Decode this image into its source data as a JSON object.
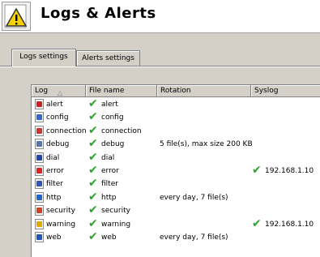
{
  "header": {
    "title": "Logs & Alerts",
    "icon": "warning-icon"
  },
  "tabs": [
    {
      "label": "Logs settings",
      "active": true
    },
    {
      "label": "Alerts settings",
      "active": false
    }
  ],
  "grid": {
    "columns": [
      "Log",
      "File name",
      "Rotation",
      "Syslog"
    ],
    "sort_indicator": "△",
    "rows": [
      {
        "log": "alert",
        "icon": "alert-icon",
        "icon_color": "#cc2222",
        "file_name": "alert",
        "file_checked": true,
        "rotation": "",
        "syslog": "",
        "syslog_checked": false
      },
      {
        "log": "config",
        "icon": "config-icon",
        "icon_color": "#3366cc",
        "file_name": "config",
        "file_checked": true,
        "rotation": "",
        "syslog": "",
        "syslog_checked": false
      },
      {
        "log": "connection",
        "icon": "connection-icon",
        "icon_color": "#cc3333",
        "file_name": "connection",
        "file_checked": true,
        "rotation": "",
        "syslog": "",
        "syslog_checked": false
      },
      {
        "log": "debug",
        "icon": "debug-icon",
        "icon_color": "#5577aa",
        "file_name": "debug",
        "file_checked": true,
        "rotation": "5 file(s), max size 200 KB",
        "syslog": "",
        "syslog_checked": false
      },
      {
        "log": "dial",
        "icon": "dial-icon",
        "icon_color": "#2244aa",
        "file_name": "dial",
        "file_checked": true,
        "rotation": "",
        "syslog": "",
        "syslog_checked": false
      },
      {
        "log": "error",
        "icon": "error-icon",
        "icon_color": "#dd2222",
        "file_name": "error",
        "file_checked": true,
        "rotation": "",
        "syslog": "192.168.1.10",
        "syslog_checked": true
      },
      {
        "log": "filter",
        "icon": "filter-icon",
        "icon_color": "#3355bb",
        "file_name": "filter",
        "file_checked": true,
        "rotation": "",
        "syslog": "",
        "syslog_checked": false
      },
      {
        "log": "http",
        "icon": "http-icon",
        "icon_color": "#2266cc",
        "file_name": "http",
        "file_checked": true,
        "rotation": "every day, 7 file(s)",
        "syslog": "",
        "syslog_checked": false
      },
      {
        "log": "security",
        "icon": "security-icon",
        "icon_color": "#cc4422",
        "file_name": "security",
        "file_checked": true,
        "rotation": "",
        "syslog": "",
        "syslog_checked": false
      },
      {
        "log": "warning",
        "icon": "warning-icon",
        "icon_color": "#ddaa00",
        "file_name": "warning",
        "file_checked": true,
        "rotation": "",
        "syslog": "192.168.1.10",
        "syslog_checked": true
      },
      {
        "log": "web",
        "icon": "web-icon",
        "icon_color": "#2255bb",
        "file_name": "web",
        "file_checked": true,
        "rotation": "every day, 7 file(s)",
        "syslog": "",
        "syslog_checked": false
      }
    ]
  },
  "colors": {
    "check": "#2aa52a",
    "window_bg": "#d4d0c8",
    "warning_yellow": "#f5d200"
  }
}
